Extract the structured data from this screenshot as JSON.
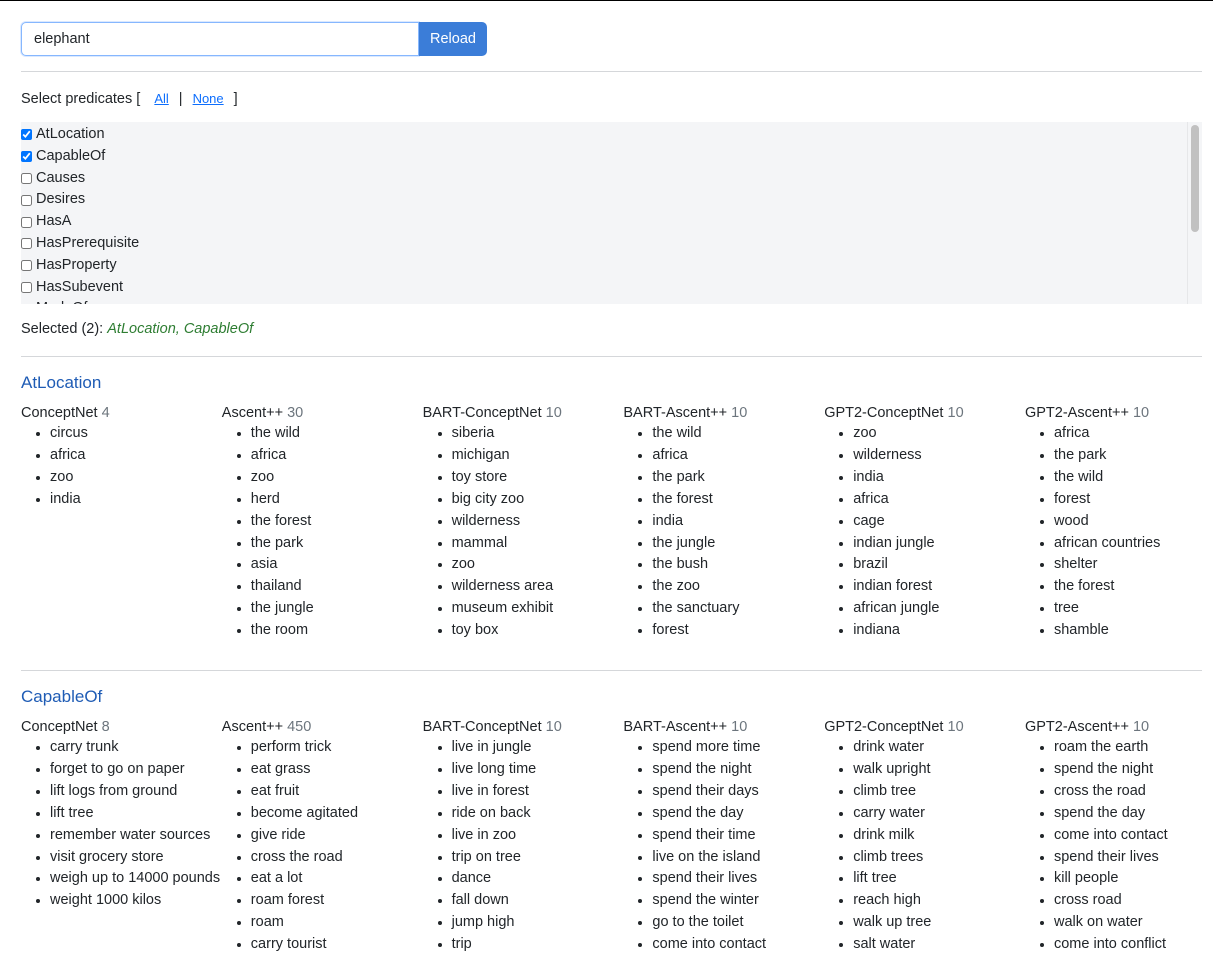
{
  "search": {
    "value": "elephant",
    "button_label": "Reload"
  },
  "predicates": {
    "header_text": "Select predicates [",
    "all_label": "All",
    "separator": "|",
    "none_label": "None",
    "close_bracket": "]",
    "items": [
      {
        "label": "AtLocation",
        "checked": true
      },
      {
        "label": "CapableOf",
        "checked": true
      },
      {
        "label": "Causes",
        "checked": false
      },
      {
        "label": "Desires",
        "checked": false
      },
      {
        "label": "HasA",
        "checked": false
      },
      {
        "label": "HasPrerequisite",
        "checked": false
      },
      {
        "label": "HasProperty",
        "checked": false
      },
      {
        "label": "HasSubevent",
        "checked": false
      },
      {
        "label": "MadeOf",
        "checked": false
      }
    ]
  },
  "selected": {
    "label": "Selected (2):",
    "values": "AtLocation, CapableOf"
  },
  "sections": [
    {
      "title": "AtLocation",
      "columns": [
        {
          "name": "ConceptNet",
          "count": "4",
          "items": [
            "circus",
            "africa",
            "zoo",
            "india"
          ]
        },
        {
          "name": "Ascent++",
          "count": "30",
          "items": [
            "the wild",
            "africa",
            "zoo",
            "herd",
            "the forest",
            "the park",
            "asia",
            "thailand",
            "the jungle",
            "the room"
          ]
        },
        {
          "name": "BART-ConceptNet",
          "count": "10",
          "items": [
            "siberia",
            "michigan",
            "toy store",
            "big city zoo",
            "wilderness",
            "mammal",
            "zoo",
            "wilderness area",
            "museum exhibit",
            "toy box"
          ]
        },
        {
          "name": "BART-Ascent++",
          "count": "10",
          "items": [
            "the wild",
            "africa",
            "the park",
            "the forest",
            "india",
            "the jungle",
            "the bush",
            "the zoo",
            "the sanctuary",
            "forest"
          ]
        },
        {
          "name": "GPT2-ConceptNet",
          "count": "10",
          "items": [
            "zoo",
            "wilderness",
            "india",
            "africa",
            "cage",
            "indian jungle",
            "brazil",
            "indian forest",
            "african jungle",
            "indiana"
          ]
        },
        {
          "name": "GPT2-Ascent++",
          "count": "10",
          "items": [
            "africa",
            "the park",
            "the wild",
            "forest",
            "wood",
            "african countries",
            "shelter",
            "the forest",
            "tree",
            "shamble"
          ]
        }
      ]
    },
    {
      "title": "CapableOf",
      "columns": [
        {
          "name": "ConceptNet",
          "count": "8",
          "items": [
            "carry trunk",
            "forget to go on paper",
            "lift logs from ground",
            "lift tree",
            "remember water sources",
            "visit grocery store",
            "weigh up to 14000 pounds",
            "weight 1000 kilos"
          ]
        },
        {
          "name": "Ascent++",
          "count": "450",
          "items": [
            "perform trick",
            "eat grass",
            "eat fruit",
            "become agitated",
            "give ride",
            "cross the road",
            "eat a lot",
            "roam forest",
            "roam",
            "carry tourist"
          ]
        },
        {
          "name": "BART-ConceptNet",
          "count": "10",
          "items": [
            "live in jungle",
            "live long time",
            "live in forest",
            "ride on back",
            "live in zoo",
            "trip on tree",
            "dance",
            "fall down",
            "jump high",
            "trip"
          ]
        },
        {
          "name": "BART-Ascent++",
          "count": "10",
          "items": [
            "spend more time",
            "spend the night",
            "spend their days",
            "spend the day",
            "spend their time",
            "live on the island",
            "spend their lives",
            "spend the winter",
            "go to the toilet",
            "come into contact"
          ]
        },
        {
          "name": "GPT2-ConceptNet",
          "count": "10",
          "items": [
            "drink water",
            "walk upright",
            "climb tree",
            "carry water",
            "drink milk",
            "climb trees",
            "lift tree",
            "reach high",
            "walk up tree",
            "salt water"
          ]
        },
        {
          "name": "GPT2-Ascent++",
          "count": "10",
          "items": [
            "roam the earth",
            "spend the night",
            "cross the road",
            "spend the day",
            "come into contact",
            "spend their lives",
            "kill people",
            "cross road",
            "walk on water",
            "come into conflict"
          ]
        }
      ]
    }
  ]
}
